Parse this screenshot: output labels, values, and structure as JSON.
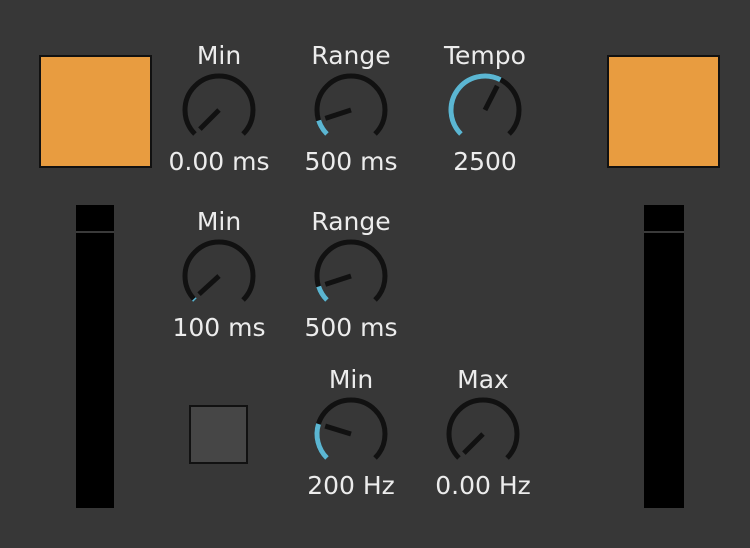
{
  "colors": {
    "background": "#373737",
    "accent_orange": "#e89c40",
    "knob_arc_blue": "#5bb6d2",
    "knob_ring": "#111111",
    "text": "#ececec"
  },
  "row1": {
    "min": {
      "label": "Min",
      "value": "0.00 ms",
      "level": 0.0
    },
    "range": {
      "label": "Range",
      "value": "500 ms",
      "level": 0.1
    },
    "tempo": {
      "label": "Tempo",
      "value": "2500",
      "level": 0.6
    }
  },
  "row2": {
    "min": {
      "label": "Min",
      "value": "100 ms",
      "level": 0.01
    },
    "range": {
      "label": "Range",
      "value": "500 ms",
      "level": 0.1
    }
  },
  "row3": {
    "min": {
      "label": "Min",
      "value": "200 Hz",
      "level": 0.23
    },
    "max": {
      "label": "Max",
      "value": "0.00 Hz",
      "level": 0.0
    }
  },
  "meters": {
    "left_level": 0.0,
    "right_level": 0.0
  }
}
